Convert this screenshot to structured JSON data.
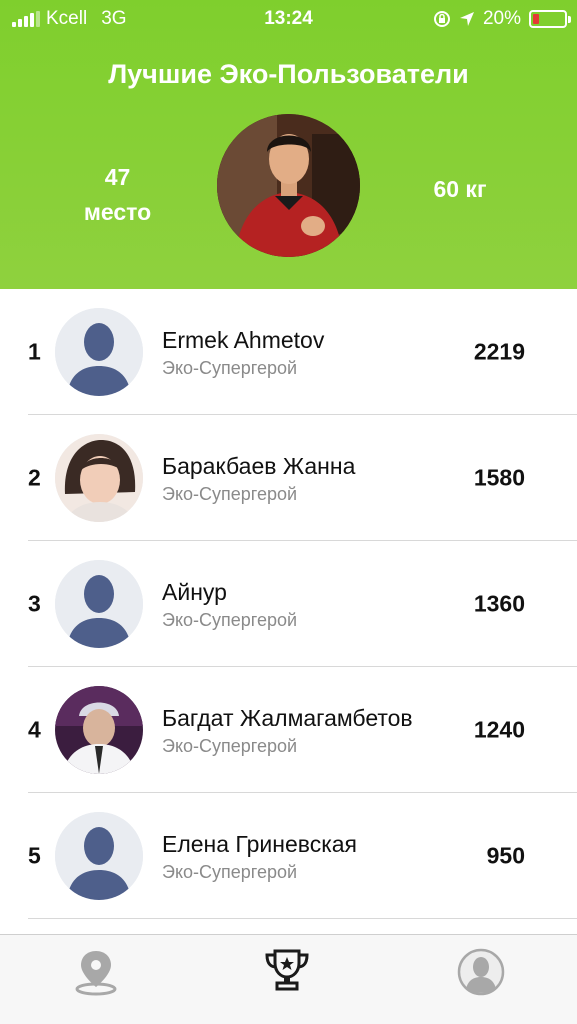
{
  "status_bar": {
    "carrier": "Kcell",
    "network": "3G",
    "time": "13:24",
    "battery": "20%",
    "battery_level": 0.2,
    "battery_color": "#e53935"
  },
  "header": {
    "title": "Лучшие Эко-Пользователи",
    "rank_number": "47",
    "rank_label": "место",
    "weight": "60 кг",
    "accent_color": "#7fcf2d"
  },
  "leaderboard": [
    {
      "rank": "1",
      "name": "Ermek Ahmetov",
      "status": "Эко-Супергерой",
      "score": "2219",
      "avatar": "default-avatar"
    },
    {
      "rank": "2",
      "name": "Баракбаев Жанна",
      "status": "Эко-Супергерой",
      "score": "1580",
      "avatar": "user-photo"
    },
    {
      "rank": "3",
      "name": "Айнур",
      "status": "Эко-Супергерой",
      "score": "1360",
      "avatar": "default-avatar"
    },
    {
      "rank": "4",
      "name": "Багдат Жалмагамбетов",
      "status": "Эко-Супергерой",
      "score": "1240",
      "avatar": "user-photo"
    },
    {
      "rank": "5",
      "name": "Елена Гриневская",
      "status": "Эко-Супергерой",
      "score": "950",
      "avatar": "default-avatar"
    }
  ],
  "tab_bar": {
    "tabs": [
      {
        "icon": "map-pin-icon",
        "active": false
      },
      {
        "icon": "trophy-icon",
        "active": true
      },
      {
        "icon": "profile-icon",
        "active": false
      }
    ]
  }
}
